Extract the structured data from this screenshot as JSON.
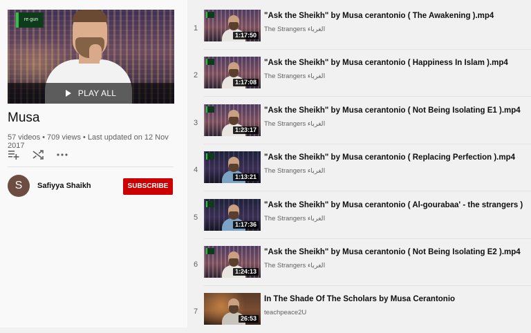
{
  "playlist": {
    "play_all_label": "PLAY ALL",
    "hero_logo_text": "re·gun",
    "title": "Musa",
    "stats": "57 videos • 709 views • Last updated on 12 Nov 2017",
    "owner_initial": "S",
    "owner_name": "Safiyya Shaikh",
    "subscribe_label": "SUBSCRIBE",
    "actions": [
      "add-to-queue-icon",
      "shuffle-icon",
      "more-icon"
    ]
  },
  "videos": [
    {
      "index": "1",
      "title": "\"Ask the Sheikh\" by Musa cerantonio ( The Awakening ).mp4",
      "channel": "The Strangers الغرباء",
      "duration": "1:17:50",
      "scene": "purple"
    },
    {
      "index": "2",
      "title": "\"Ask the Sheikh\" by Musa cerantonio ( Happiness In Islam ).mp4",
      "channel": "The Strangers الغرباء",
      "duration": "1:17:08",
      "scene": "purple"
    },
    {
      "index": "3",
      "title": "\"Ask the Sheikh\" by Musa cerantonio ( Not Being Isolating E1 ).mp4",
      "channel": "The Strangers الغرباء",
      "duration": "1:23:17",
      "scene": "purple"
    },
    {
      "index": "4",
      "title": "\"Ask the Sheikh\" by Musa cerantonio ( Replacing Perfection ).mp4",
      "channel": "The Strangers الغرباء",
      "duration": "1:13:21",
      "scene": "dark"
    },
    {
      "index": "5",
      "title": "\"Ask the Sheikh\" by Musa cerantonio ( Al-gourabaa' - the strangers )",
      "channel": "The Strangers الغرباء",
      "duration": "1:17:36",
      "scene": "dark"
    },
    {
      "index": "6",
      "title": "\"Ask the Sheikh\" by Musa cerantonio ( Not Being Isolating E2 ).mp4",
      "channel": "The Strangers الغرباء",
      "duration": "1:24:13",
      "scene": "purple"
    },
    {
      "index": "7",
      "title": "In The Shade Of The Scholars by Musa Cerantonio",
      "channel": "teachpeace2U",
      "duration": "26:53",
      "scene": "warm"
    }
  ],
  "colors": {
    "subscribe": "#cc0000",
    "avatar": "#6d4c41",
    "page_bg": "#f1f1f1"
  }
}
